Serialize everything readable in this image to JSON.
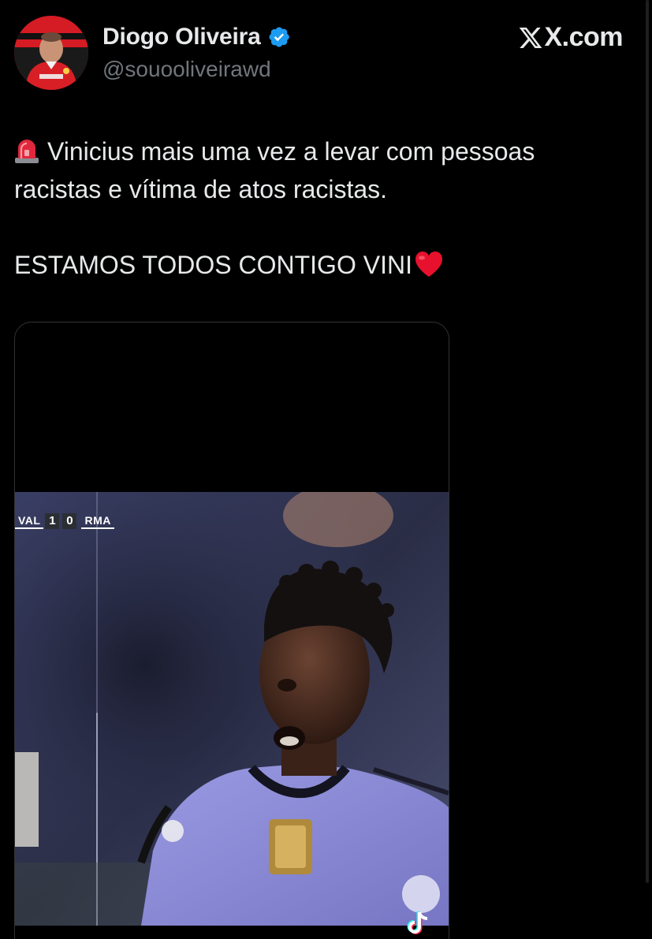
{
  "tweet": {
    "author": {
      "display_name": "Diogo Oliveira",
      "handle": "@souooliveirawd",
      "verified": true,
      "avatar_icon": "avatar-photo"
    },
    "watermark": "X.com",
    "text_lines": [
      "Vinicius mais uma vez a levar com pessoas",
      "racistas e vítima de atos racistas.",
      "",
      "ESTAMOS TODOS CONTIGO VINI"
    ],
    "emoji": {
      "leading": "siren-icon",
      "trailing": "red-heart-icon"
    }
  },
  "media": {
    "type": "video",
    "scoreboard": {
      "home_team": "VAL",
      "home_score": "1",
      "away_score": "0",
      "away_team": "RMA",
      "flag_icon": "ukraine-flag-icon"
    },
    "overlay_icon": "tiktok-icon"
  },
  "colors": {
    "background": "#000000",
    "text_primary": "#e7e9ea",
    "text_secondary": "#71767b",
    "verified_blue": "#1d9bf0",
    "heart_red": "#e8112d",
    "jersey_purple": "#8f8fd8"
  }
}
